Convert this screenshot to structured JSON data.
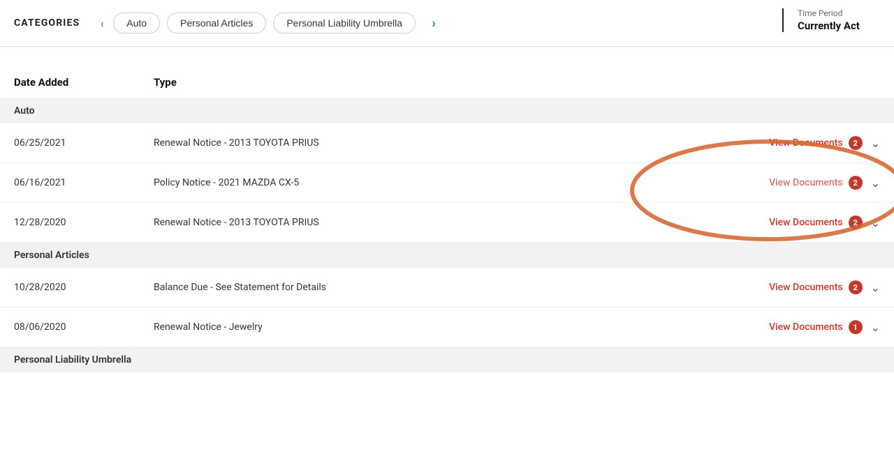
{
  "header": {
    "categories_label": "CATEGORIES",
    "nav_prev_icon": "‹",
    "nav_next_icon": "›",
    "tabs": [
      {
        "label": "Auto",
        "id": "auto"
      },
      {
        "label": "Personal Articles",
        "id": "personal-articles"
      },
      {
        "label": "Personal Liability Umbrella",
        "id": "personal-liability-umbrella"
      }
    ],
    "time_period": {
      "label": "Time Period",
      "value": "Currently Act"
    }
  },
  "table": {
    "columns": {
      "date_added": "Date Added",
      "type": "Type"
    },
    "sections": [
      {
        "section_label": "Auto",
        "rows": [
          {
            "date": "06/25/2021",
            "type": "Renewal Notice - 2013 TOYOTA PRIUS",
            "action_label": "View Documents",
            "count": "2",
            "highlighted": true
          },
          {
            "date": "06/16/2021",
            "type": "Policy Notice - 2021 MAZDA CX-5",
            "action_label": "View Documents",
            "count": "2",
            "highlighted": false
          },
          {
            "date": "12/28/2020",
            "type": "Renewal Notice - 2013 TOYOTA PRIUS",
            "action_label": "View Documents",
            "count": "2",
            "highlighted": false
          }
        ]
      },
      {
        "section_label": "Personal Articles",
        "rows": [
          {
            "date": "10/28/2020",
            "type": "Balance Due - See Statement for Details",
            "action_label": "View Documents",
            "count": "2",
            "highlighted": false
          },
          {
            "date": "08/06/2020",
            "type": "Renewal Notice - Jewelry",
            "action_label": "View Documents",
            "count": "1",
            "highlighted": false
          }
        ]
      },
      {
        "section_label": "Personal Liability Umbrella",
        "rows": []
      }
    ]
  }
}
